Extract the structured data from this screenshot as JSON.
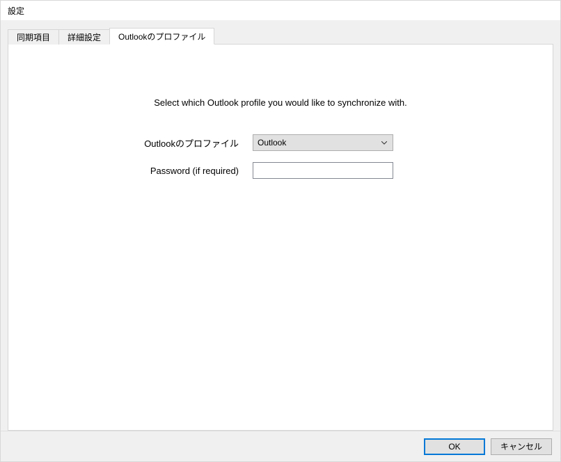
{
  "window": {
    "title": "設定"
  },
  "tabs": {
    "sync_items": "同期項目",
    "advanced": "詳細設定",
    "outlook_profile": "Outlookのプロファイル"
  },
  "panel": {
    "instruction": "Select which Outlook profile you would like to synchronize with.",
    "profile_label": "Outlookのプロファイル",
    "profile_value": "Outlook",
    "password_label": "Password (if required)",
    "password_value": ""
  },
  "buttons": {
    "ok": "OK",
    "cancel": "キャンセル"
  }
}
